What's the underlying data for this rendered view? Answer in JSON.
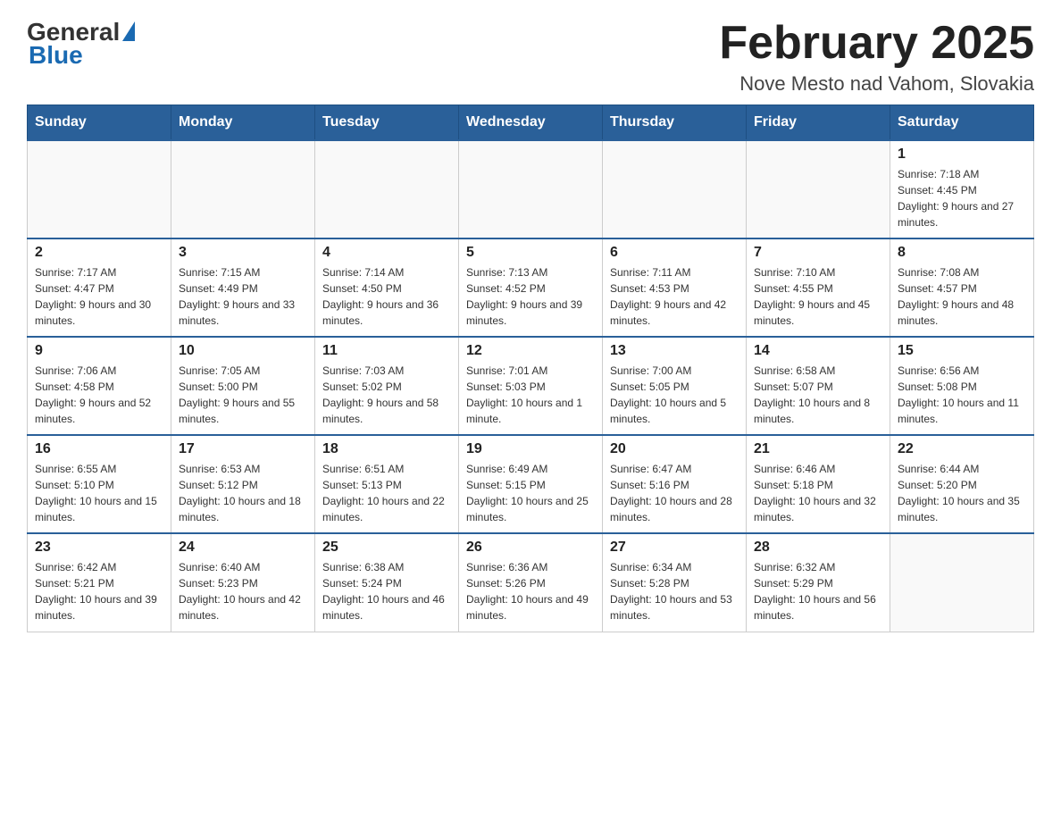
{
  "header": {
    "logo_general": "General",
    "logo_blue": "Blue",
    "month_title": "February 2025",
    "location": "Nove Mesto nad Vahom, Slovakia"
  },
  "weekdays": [
    "Sunday",
    "Monday",
    "Tuesday",
    "Wednesday",
    "Thursday",
    "Friday",
    "Saturday"
  ],
  "weeks": [
    [
      {
        "day": "",
        "sunrise": "",
        "sunset": "",
        "daylight": ""
      },
      {
        "day": "",
        "sunrise": "",
        "sunset": "",
        "daylight": ""
      },
      {
        "day": "",
        "sunrise": "",
        "sunset": "",
        "daylight": ""
      },
      {
        "day": "",
        "sunrise": "",
        "sunset": "",
        "daylight": ""
      },
      {
        "day": "",
        "sunrise": "",
        "sunset": "",
        "daylight": ""
      },
      {
        "day": "",
        "sunrise": "",
        "sunset": "",
        "daylight": ""
      },
      {
        "day": "1",
        "sunrise": "Sunrise: 7:18 AM",
        "sunset": "Sunset: 4:45 PM",
        "daylight": "Daylight: 9 hours and 27 minutes."
      }
    ],
    [
      {
        "day": "2",
        "sunrise": "Sunrise: 7:17 AM",
        "sunset": "Sunset: 4:47 PM",
        "daylight": "Daylight: 9 hours and 30 minutes."
      },
      {
        "day": "3",
        "sunrise": "Sunrise: 7:15 AM",
        "sunset": "Sunset: 4:49 PM",
        "daylight": "Daylight: 9 hours and 33 minutes."
      },
      {
        "day": "4",
        "sunrise": "Sunrise: 7:14 AM",
        "sunset": "Sunset: 4:50 PM",
        "daylight": "Daylight: 9 hours and 36 minutes."
      },
      {
        "day": "5",
        "sunrise": "Sunrise: 7:13 AM",
        "sunset": "Sunset: 4:52 PM",
        "daylight": "Daylight: 9 hours and 39 minutes."
      },
      {
        "day": "6",
        "sunrise": "Sunrise: 7:11 AM",
        "sunset": "Sunset: 4:53 PM",
        "daylight": "Daylight: 9 hours and 42 minutes."
      },
      {
        "day": "7",
        "sunrise": "Sunrise: 7:10 AM",
        "sunset": "Sunset: 4:55 PM",
        "daylight": "Daylight: 9 hours and 45 minutes."
      },
      {
        "day": "8",
        "sunrise": "Sunrise: 7:08 AM",
        "sunset": "Sunset: 4:57 PM",
        "daylight": "Daylight: 9 hours and 48 minutes."
      }
    ],
    [
      {
        "day": "9",
        "sunrise": "Sunrise: 7:06 AM",
        "sunset": "Sunset: 4:58 PM",
        "daylight": "Daylight: 9 hours and 52 minutes."
      },
      {
        "day": "10",
        "sunrise": "Sunrise: 7:05 AM",
        "sunset": "Sunset: 5:00 PM",
        "daylight": "Daylight: 9 hours and 55 minutes."
      },
      {
        "day": "11",
        "sunrise": "Sunrise: 7:03 AM",
        "sunset": "Sunset: 5:02 PM",
        "daylight": "Daylight: 9 hours and 58 minutes."
      },
      {
        "day": "12",
        "sunrise": "Sunrise: 7:01 AM",
        "sunset": "Sunset: 5:03 PM",
        "daylight": "Daylight: 10 hours and 1 minute."
      },
      {
        "day": "13",
        "sunrise": "Sunrise: 7:00 AM",
        "sunset": "Sunset: 5:05 PM",
        "daylight": "Daylight: 10 hours and 5 minutes."
      },
      {
        "day": "14",
        "sunrise": "Sunrise: 6:58 AM",
        "sunset": "Sunset: 5:07 PM",
        "daylight": "Daylight: 10 hours and 8 minutes."
      },
      {
        "day": "15",
        "sunrise": "Sunrise: 6:56 AM",
        "sunset": "Sunset: 5:08 PM",
        "daylight": "Daylight: 10 hours and 11 minutes."
      }
    ],
    [
      {
        "day": "16",
        "sunrise": "Sunrise: 6:55 AM",
        "sunset": "Sunset: 5:10 PM",
        "daylight": "Daylight: 10 hours and 15 minutes."
      },
      {
        "day": "17",
        "sunrise": "Sunrise: 6:53 AM",
        "sunset": "Sunset: 5:12 PM",
        "daylight": "Daylight: 10 hours and 18 minutes."
      },
      {
        "day": "18",
        "sunrise": "Sunrise: 6:51 AM",
        "sunset": "Sunset: 5:13 PM",
        "daylight": "Daylight: 10 hours and 22 minutes."
      },
      {
        "day": "19",
        "sunrise": "Sunrise: 6:49 AM",
        "sunset": "Sunset: 5:15 PM",
        "daylight": "Daylight: 10 hours and 25 minutes."
      },
      {
        "day": "20",
        "sunrise": "Sunrise: 6:47 AM",
        "sunset": "Sunset: 5:16 PM",
        "daylight": "Daylight: 10 hours and 28 minutes."
      },
      {
        "day": "21",
        "sunrise": "Sunrise: 6:46 AM",
        "sunset": "Sunset: 5:18 PM",
        "daylight": "Daylight: 10 hours and 32 minutes."
      },
      {
        "day": "22",
        "sunrise": "Sunrise: 6:44 AM",
        "sunset": "Sunset: 5:20 PM",
        "daylight": "Daylight: 10 hours and 35 minutes."
      }
    ],
    [
      {
        "day": "23",
        "sunrise": "Sunrise: 6:42 AM",
        "sunset": "Sunset: 5:21 PM",
        "daylight": "Daylight: 10 hours and 39 minutes."
      },
      {
        "day": "24",
        "sunrise": "Sunrise: 6:40 AM",
        "sunset": "Sunset: 5:23 PM",
        "daylight": "Daylight: 10 hours and 42 minutes."
      },
      {
        "day": "25",
        "sunrise": "Sunrise: 6:38 AM",
        "sunset": "Sunset: 5:24 PM",
        "daylight": "Daylight: 10 hours and 46 minutes."
      },
      {
        "day": "26",
        "sunrise": "Sunrise: 6:36 AM",
        "sunset": "Sunset: 5:26 PM",
        "daylight": "Daylight: 10 hours and 49 minutes."
      },
      {
        "day": "27",
        "sunrise": "Sunrise: 6:34 AM",
        "sunset": "Sunset: 5:28 PM",
        "daylight": "Daylight: 10 hours and 53 minutes."
      },
      {
        "day": "28",
        "sunrise": "Sunrise: 6:32 AM",
        "sunset": "Sunset: 5:29 PM",
        "daylight": "Daylight: 10 hours and 56 minutes."
      },
      {
        "day": "",
        "sunrise": "",
        "sunset": "",
        "daylight": ""
      }
    ]
  ]
}
